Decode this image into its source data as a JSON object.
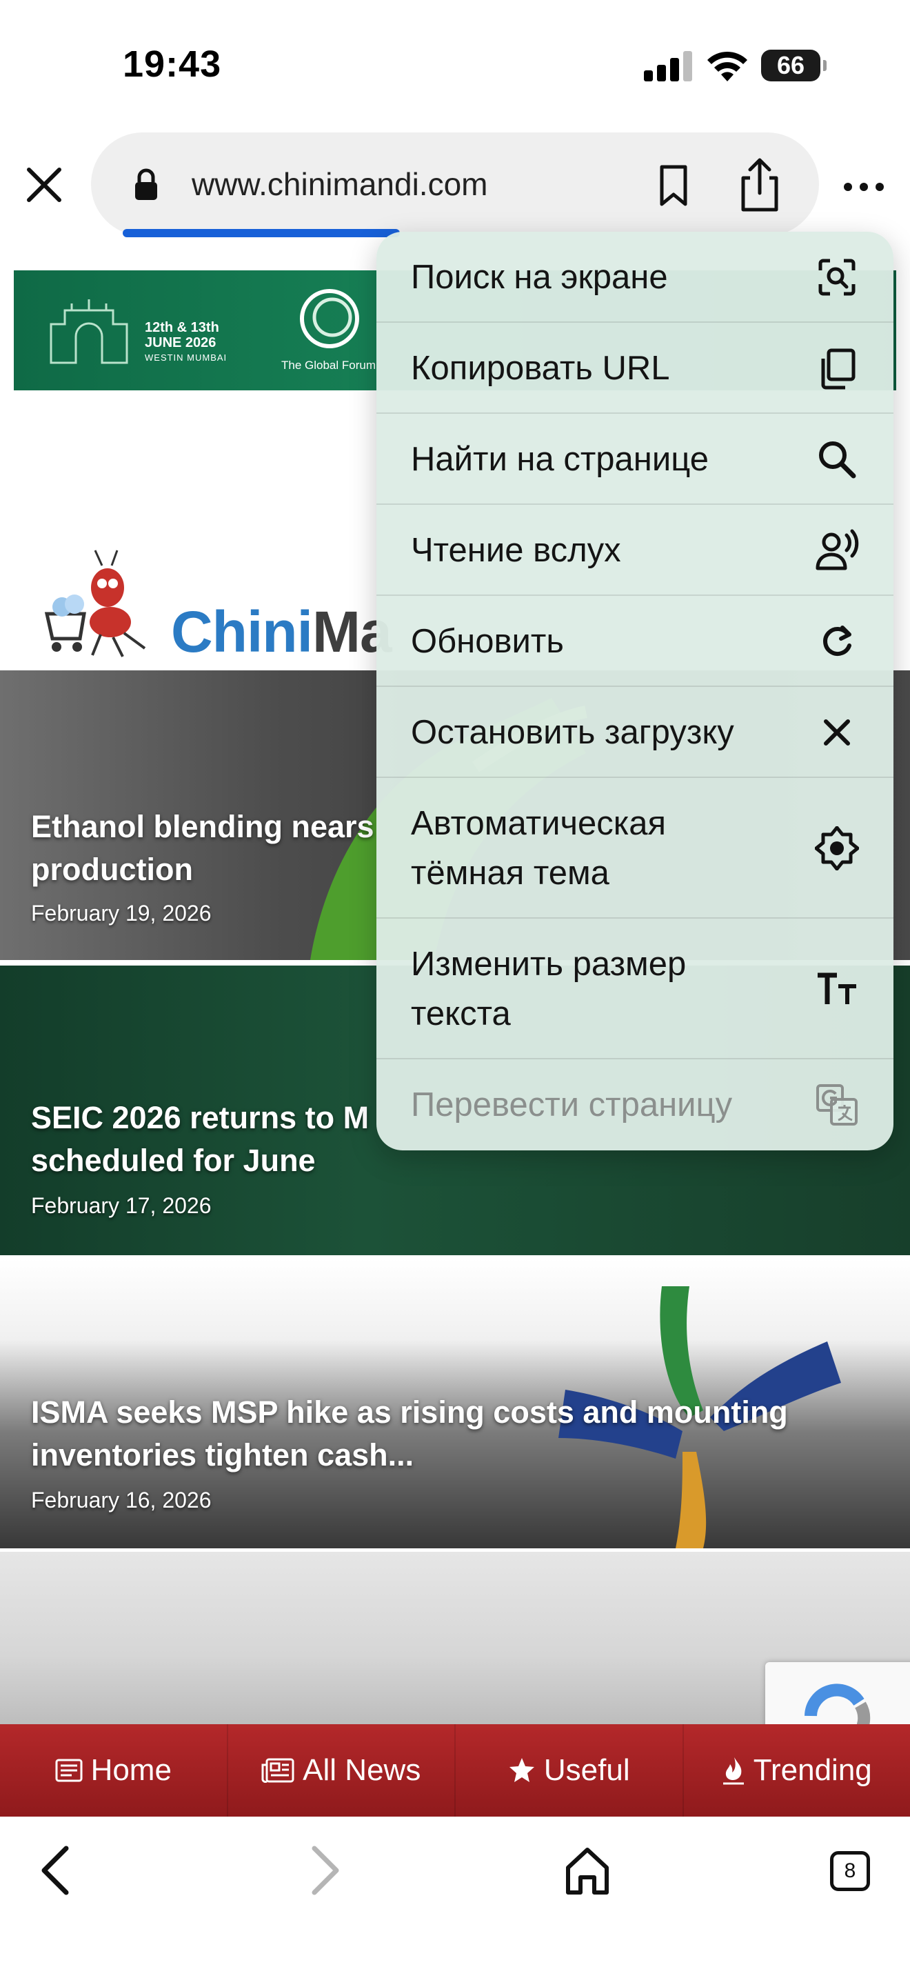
{
  "status": {
    "time": "19:43",
    "battery": "66"
  },
  "address_bar": {
    "url": "www.chinimandi.com"
  },
  "banner": {
    "date_line1": "12th & 13th",
    "date_line2": "JUNE 2026",
    "venue": "WESTIN MUMBAI",
    "forum": "The Global Forum"
  },
  "logo": {
    "part1": "Chini",
    "part2": "Ma"
  },
  "articles": [
    {
      "title": "Ethanol blending nears",
      "title_line2": "production",
      "date": "February 19, 2026"
    },
    {
      "title": "SEIC 2026 returns to M",
      "title_line2": "scheduled for June",
      "date": "February 17, 2026"
    },
    {
      "title": "ISMA seeks MSP hike as rising costs and mounting",
      "title_line2": "inventories tighten cash...",
      "date": "February 16, 2026"
    }
  ],
  "site_nav": [
    {
      "label": "Home",
      "icon": "newspaper-icon"
    },
    {
      "label": "All News",
      "icon": "news-icon"
    },
    {
      "label": "Useful",
      "icon": "star-icon"
    },
    {
      "label": "Trending",
      "icon": "fire-icon"
    }
  ],
  "toolbar": {
    "tabs_count": "8"
  },
  "menu": {
    "items": [
      {
        "label": "Поиск на экране",
        "icon": "lens-search-icon"
      },
      {
        "label": "Копировать URL",
        "icon": "copy-icon"
      },
      {
        "label": "Найти на странице",
        "icon": "search-icon"
      },
      {
        "label": "Чтение вслух",
        "icon": "read-aloud-icon"
      },
      {
        "label": "Обновить",
        "icon": "reload-icon"
      },
      {
        "label": "Остановить загрузку",
        "icon": "close-icon"
      },
      {
        "label": "Автоматическая",
        "label_line2": "тёмная тема",
        "icon": "dark-theme-icon"
      },
      {
        "label": "Изменить размер",
        "label_line2": "текста",
        "icon": "text-size-icon"
      },
      {
        "label": "Перевести страницу",
        "icon": "translate-icon",
        "disabled": true
      }
    ]
  }
}
